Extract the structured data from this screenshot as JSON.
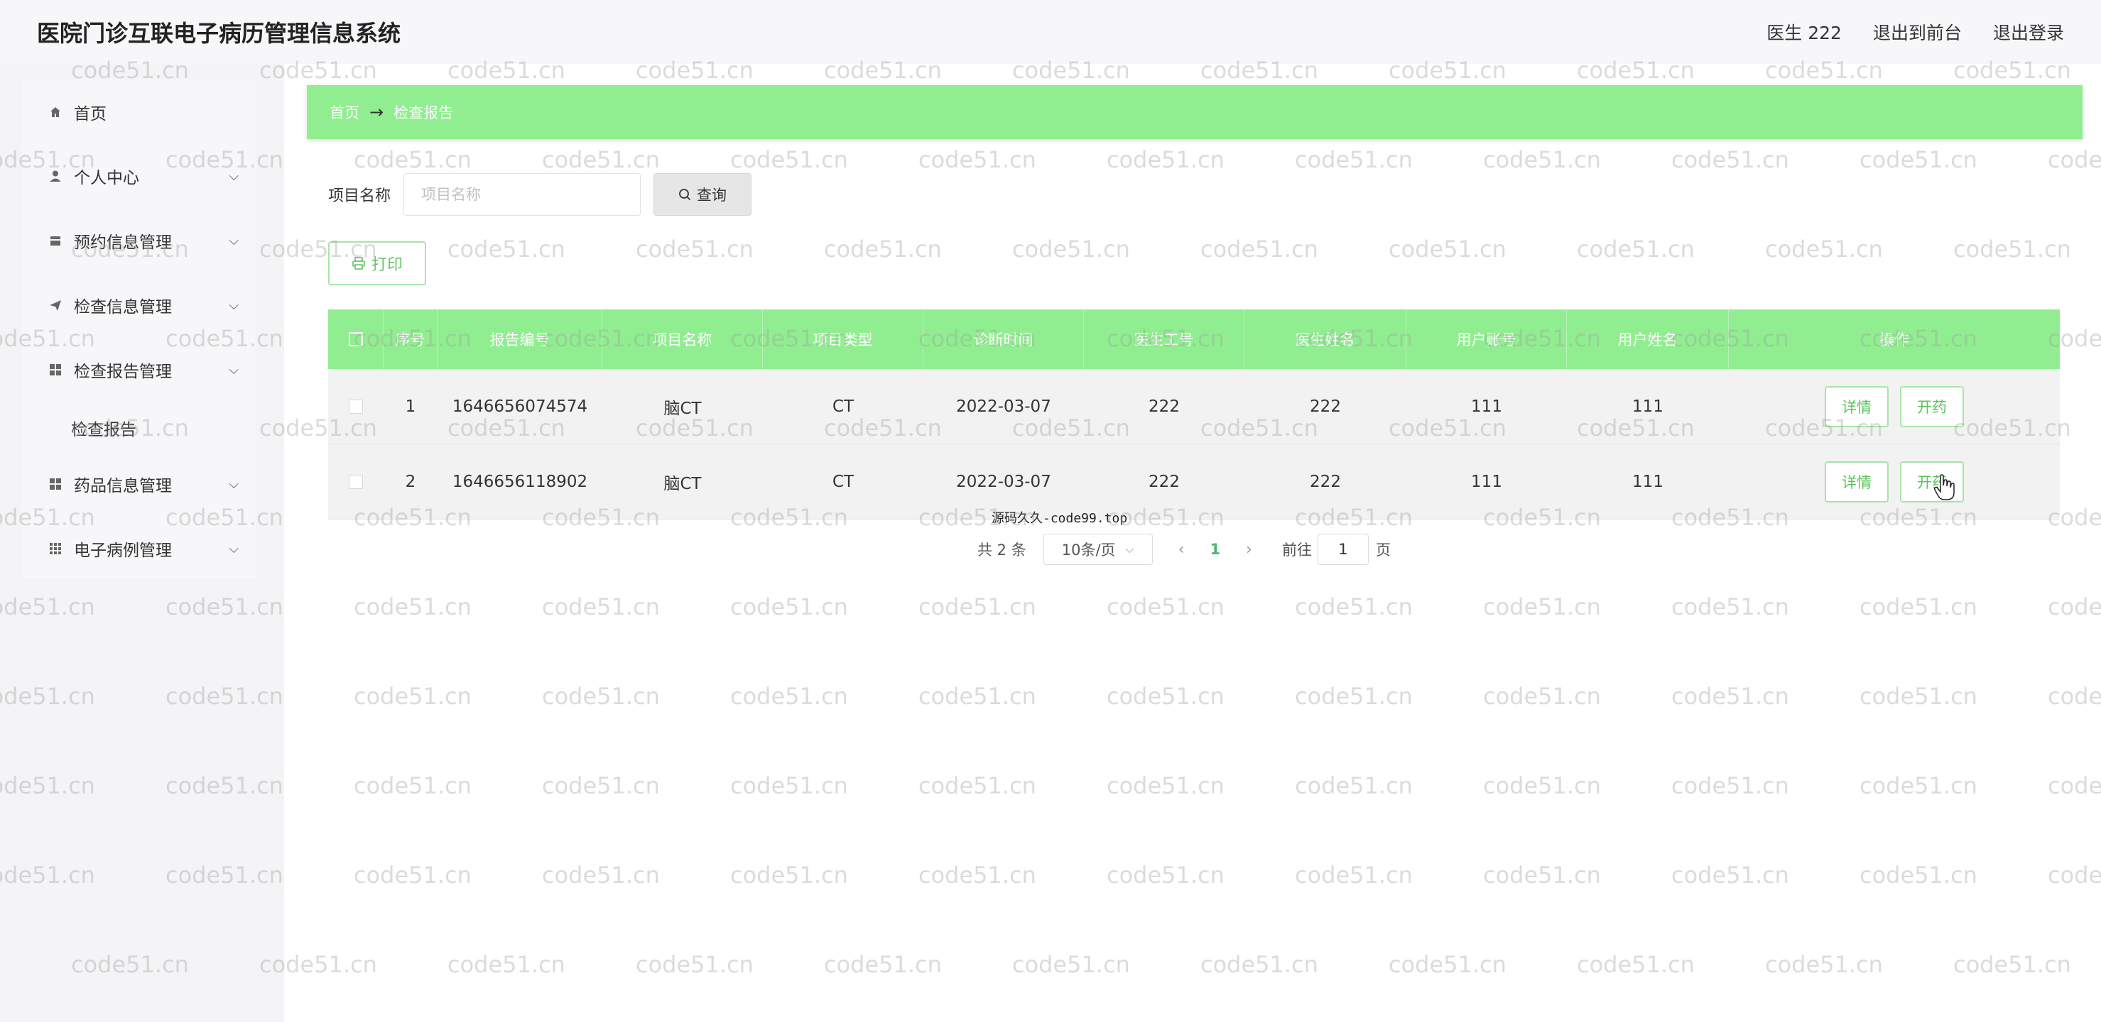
{
  "header": {
    "title": "医院门诊互联电子病历管理信息系统",
    "user": "医生 222",
    "back_to_front": "退出到前台",
    "logout": "退出登录"
  },
  "sidebar": {
    "items": [
      {
        "label": "首页",
        "icon": "home-icon"
      },
      {
        "label": "个人中心",
        "icon": "user-icon"
      },
      {
        "label": "预约信息管理",
        "icon": "calendar-icon"
      },
      {
        "label": "检查信息管理",
        "icon": "send-icon"
      },
      {
        "label": "检查报告管理",
        "icon": "grid-icon"
      },
      {
        "label": "药品信息管理",
        "icon": "grid-icon"
      },
      {
        "label": "电子病例管理",
        "icon": "apps-icon"
      }
    ],
    "sub_item": "检查报告"
  },
  "breadcrumb": {
    "home": "首页",
    "current": "检查报告"
  },
  "search": {
    "label": "项目名称",
    "placeholder": "项目名称",
    "button": "查询"
  },
  "print_button": "打印",
  "table": {
    "headers": [
      "序号",
      "报告编号",
      "项目名称",
      "项目类型",
      "诊断时间",
      "医生工号",
      "医生姓名",
      "用户账号",
      "用户姓名",
      "操作"
    ],
    "rows": [
      [
        "1",
        "1646656074574",
        "脑CT",
        "CT",
        "2022-03-07",
        "222",
        "222",
        "111",
        "111"
      ],
      [
        "2",
        "1646656118902",
        "脑CT",
        "CT",
        "2022-03-07",
        "222",
        "222",
        "111",
        "111"
      ]
    ],
    "detail_btn": "详情",
    "prescribe_btn": "开药"
  },
  "footer_watermark": "源码久久-code99.top",
  "pagination": {
    "total": "共 2 条",
    "page_size": "10条/页",
    "current": "1",
    "goto_label": "前往",
    "goto_value": "1",
    "goto_suffix": "页"
  },
  "watermark_text": "code51.cn",
  "colors": {
    "accent": "#90ee90",
    "button_text": "#5cc45c"
  }
}
